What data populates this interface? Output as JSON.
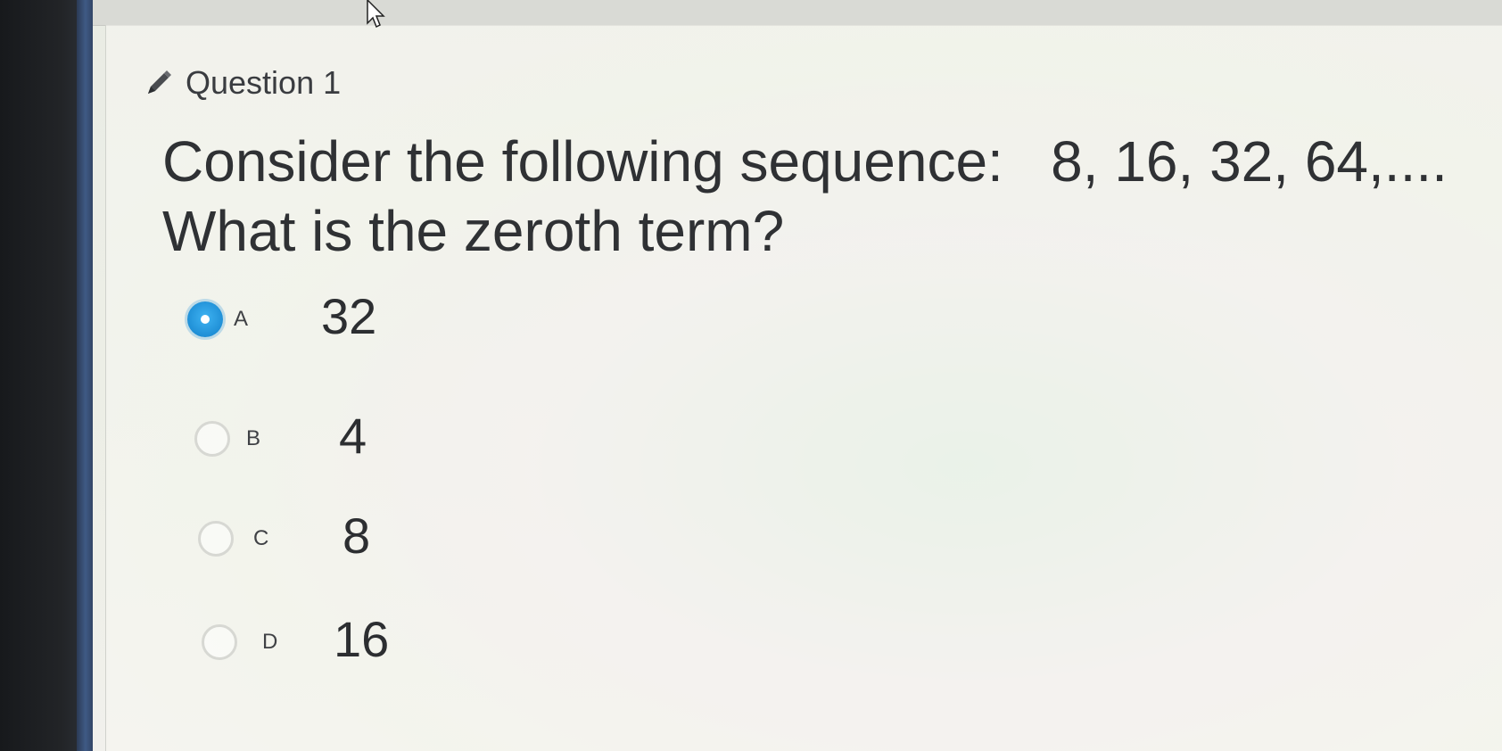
{
  "question": {
    "title": "Question 1",
    "prompt_line1": "Consider the following sequence:   8, 16, 32, 64,....",
    "prompt_line2": "What is the zeroth term?"
  },
  "options": [
    {
      "letter": "A",
      "value": "32",
      "selected": true
    },
    {
      "letter": "B",
      "value": "4",
      "selected": false
    },
    {
      "letter": "C",
      "value": "8",
      "selected": false
    },
    {
      "letter": "D",
      "value": "16",
      "selected": false
    }
  ],
  "colors": {
    "selected_radio": "#1f8fd6",
    "text": "#2f3134"
  },
  "icons": {
    "header": "pencil-icon",
    "pointer": "mouse-cursor-icon"
  }
}
